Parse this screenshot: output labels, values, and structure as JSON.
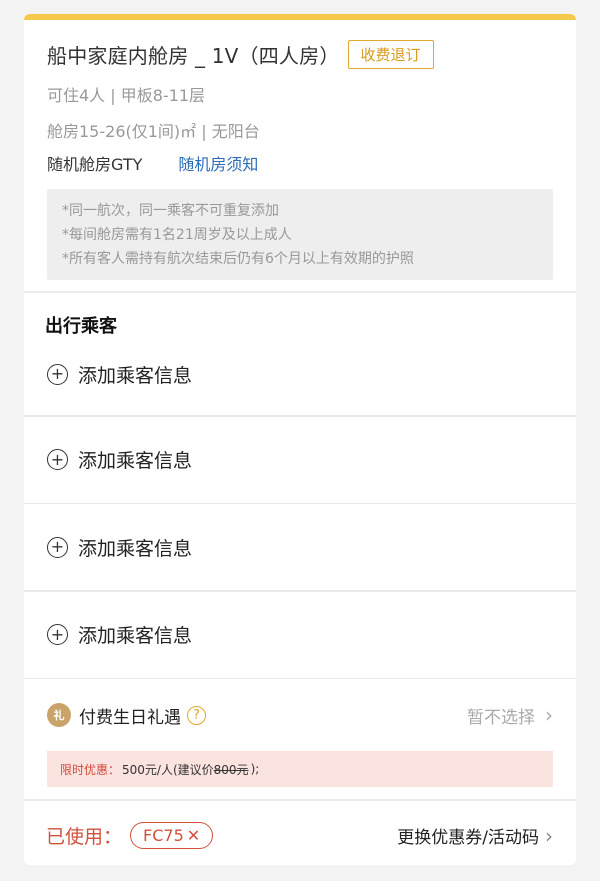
{
  "cabin": {
    "title": "船中家庭内舱房 _ 1V（四人房）",
    "refund_badge": "收费退订",
    "capacity_deck": "可住4人 | 甲板8-11层",
    "size_balcony": "舱房15-26(仅1间)㎡ | 无阳台",
    "room_type": "随机舱房GTY",
    "room_notice": "随机房须知",
    "notices": [
      "*同一航次，同一乘客不可重复添加",
      "*每间舱房需有1名21周岁及以上成人",
      "*所有客人需持有航次结束后仍有6个月以上有效期的护照"
    ]
  },
  "passengers": {
    "header": "出行乘客",
    "items": [
      {
        "label": "添加乘客信息",
        "icon": "plus-circle-icon"
      },
      {
        "label": "添加乘客信息",
        "icon": "plus-circle-icon"
      },
      {
        "label": "添加乘客信息",
        "icon": "plus-circle-icon"
      },
      {
        "label": "添加乘客信息",
        "icon": "plus-circle-icon"
      }
    ]
  },
  "birthday_gift": {
    "label": "付费生日礼遇",
    "help_icon": "?",
    "selection": "暂不选择"
  },
  "promo": {
    "label": "限时优惠：",
    "price": "500元/人(建议价",
    "original": "800元",
    "suffix": ");"
  },
  "coupon": {
    "used_label": "已使用：",
    "code": "FC75",
    "change_label": "更换优惠券/活动码"
  },
  "colors": {
    "accent_yellow": "#f4c84a",
    "badge_orange": "#e0a82e",
    "link_blue": "#2a6cb8",
    "coupon_red": "#d2513c",
    "promo_bg": "#fbe3e0"
  }
}
